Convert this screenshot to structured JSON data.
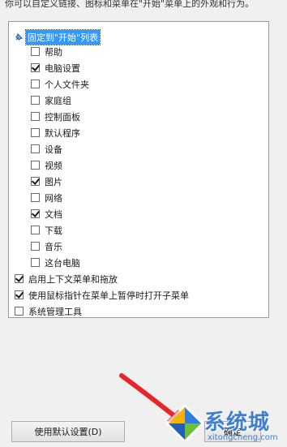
{
  "header": {
    "description": "你可以自定义链接、图标和菜单在\"开始\"菜单上的外观和行为。"
  },
  "options": {
    "group_label": "固定到\"开始\"列表",
    "group_items": [
      {
        "label": "帮助",
        "checked": false
      },
      {
        "label": "电脑设置",
        "checked": true
      },
      {
        "label": "个人文件夹",
        "checked": false
      },
      {
        "label": "家庭组",
        "checked": false
      },
      {
        "label": "控制面板",
        "checked": false
      },
      {
        "label": "默认程序",
        "checked": false
      },
      {
        "label": "设备",
        "checked": false
      },
      {
        "label": "视频",
        "checked": false
      },
      {
        "label": "图片",
        "checked": true
      },
      {
        "label": "网络",
        "checked": false
      },
      {
        "label": "文档",
        "checked": true
      },
      {
        "label": "下载",
        "checked": false
      },
      {
        "label": "音乐",
        "checked": false
      },
      {
        "label": "这台电脑",
        "checked": false
      }
    ],
    "top_items": [
      {
        "label": "启用上下文菜单和拖放",
        "checked": true
      },
      {
        "label": "使用鼠标指针在菜单上暂停时打开子菜单",
        "checked": true
      },
      {
        "label": "系统管理工具",
        "checked": false
      }
    ]
  },
  "buttons": {
    "use_defaults": "使用默认设置(D)",
    "ok": "确定"
  },
  "watermark": {
    "title": "系统城",
    "domain": "xitongcheng.com"
  },
  "colors": {
    "selection": "#3399ff",
    "arrow": "#e8262a",
    "watermark_blue": "#3f7fd1"
  }
}
